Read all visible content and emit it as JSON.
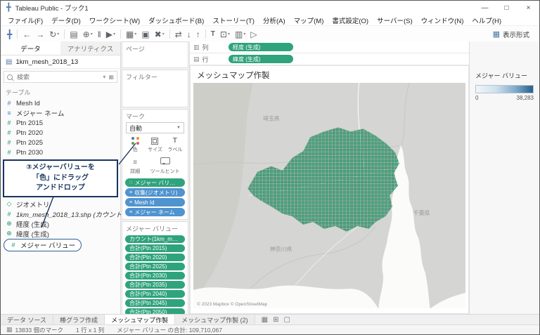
{
  "colors": {
    "pill_green": "#2fa37c",
    "pill_blue": "#4f93cf",
    "mesh_green": "#3fa077",
    "callout_navy": "#17355e",
    "legend_gradient_start": "#f0f6fb",
    "legend_gradient_end": "#26608a"
  },
  "titlebar": {
    "title": "Tableau Public - ブック1",
    "minimize": "—",
    "maximize": "□",
    "close": "×"
  },
  "menubar": {
    "items": [
      "ファイル(F)",
      "データ(D)",
      "ワークシート(W)",
      "ダッシュボード(B)",
      "ストーリー(T)",
      "分析(A)",
      "マップ(M)",
      "書式設定(O)",
      "サーバー(S)",
      "ウィンドウ(N)",
      "ヘルプ(H)"
    ]
  },
  "toolbar": {
    "show_me": "表示形式"
  },
  "data_pane": {
    "tabs": [
      "データ",
      "アナリティクス"
    ],
    "source": "1km_mesh_2018_13",
    "search_placeholder": "検索",
    "tables_label": "テーブル",
    "fields_top": [
      {
        "label": "Mesh Id",
        "icon": "#"
      },
      {
        "label": "メジャー ネーム",
        "icon": "≡"
      },
      {
        "label": "Ptn 2015",
        "icon": "#"
      },
      {
        "label": "Ptn 2020",
        "icon": "#"
      },
      {
        "label": "Ptn 2025",
        "icon": "#"
      },
      {
        "label": "Ptn 2030",
        "icon": "#"
      }
    ],
    "callout": {
      "line1": "③メジャーバリューを",
      "line2": "「色」にドラッグ",
      "line3": "アンドドロップ"
    },
    "fields_bottom": [
      {
        "label": "ジオメトリ",
        "icon": "◇"
      },
      {
        "label": "1km_mesh_2018_13.shp (カウント)",
        "icon": "#"
      },
      {
        "label": "経度 (生成)",
        "icon": "⊕"
      },
      {
        "label": "緯度 (生成)",
        "icon": "⊕"
      }
    ],
    "selected_field": {
      "label": "メジャー バリュー",
      "icon": "#"
    }
  },
  "cards": {
    "pages_label": "ページ",
    "filters_label": "フィルター",
    "marks": {
      "label": "マーク",
      "type": "自動",
      "buttons": [
        "色",
        "サイズ",
        "ラベル",
        "詳細",
        "ツールヒント"
      ],
      "pills": [
        {
          "label": "メジャー バリュー"
        },
        {
          "label": "収集(ジオメトリ)"
        },
        {
          "label": "Mesh Id"
        },
        {
          "label": "メジャー ネーム"
        }
      ]
    },
    "measure_values": {
      "label": "メジャー バリュー",
      "pills": [
        "カウント(1km_mesh_...",
        "合計(Ptn 2015)",
        "合計(Ptn 2020)",
        "合計(Ptn 2025)",
        "合計(Ptn 2030)",
        "合計(Ptn 2035)",
        "合計(Ptn 2040)",
        "合計(Ptn 2045)",
        "合計(Ptn 2050)"
      ]
    }
  },
  "shelves": {
    "columns_label": "列",
    "columns_pill": "経度 (生成)",
    "rows_label": "行",
    "rows_pill": "緯度 (生成)"
  },
  "view": {
    "title": "メッシュマップ作製",
    "map_labels": [
      "埼玉県",
      "千葉県",
      "神奈川県"
    ],
    "attribution": "© 2023 Mapbox © OpenStreetMap"
  },
  "legend": {
    "title": "メジャー バリュー",
    "min": "0",
    "max": "38,283"
  },
  "sheet_tabs": [
    "データ ソース",
    "棒グラフ作成",
    "メッシュマップ作製",
    "メッシュマップ作製 (2)"
  ],
  "statusbar": {
    "marks": "13833 個のマーク",
    "grid": "1 行 x 1 列",
    "sum": "メジャー バリュー の合計: 109,710,067"
  }
}
